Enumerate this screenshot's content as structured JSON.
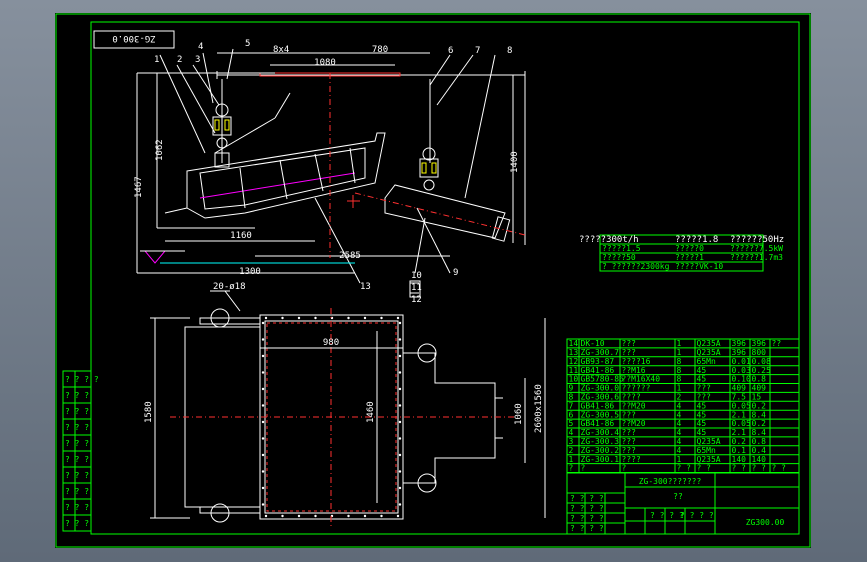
{
  "title_box": {
    "code": "ZG-300.0"
  },
  "part_numbers": [
    "1",
    "2",
    "3",
    "4",
    "5",
    "6",
    "7",
    "8",
    "9",
    "10",
    "11",
    "12",
    "13"
  ],
  "dimensions": {
    "top_8x4": "8x4",
    "top_780": "780",
    "top_1080": "1080",
    "h_1062": "1062",
    "h_1467": "1467",
    "h_1400": "1400",
    "w_1160": "1160",
    "w_1300": "1300",
    "w_2585": "2585",
    "plan_hole": "20-ø18",
    "plan_980": "980",
    "plan_1580": "1580",
    "plan_1460": "1460",
    "plan_1060": "1060",
    "plan_side": "2600x1560"
  },
  "spec_table": {
    "rows": [
      [
        "?????300t/h",
        "?????1.8",
        "??????50Hz"
      ],
      [
        "?????1.5",
        "?????0",
        "??????7.5kW"
      ],
      [
        "?????50",
        "?????1",
        "??????1.7m3"
      ],
      [
        "? ??????2300kg",
        "?????VK-10",
        ""
      ]
    ]
  },
  "parts_list": {
    "rows": [
      [
        "14",
        "DK-10",
        "???",
        "1",
        "Q235A",
        "396",
        "396",
        "??"
      ],
      [
        "13",
        "ZG-300.7",
        "???",
        "1",
        "Q235A",
        "396",
        "800",
        ""
      ],
      [
        "12",
        "GB93-87",
        "????16",
        "8",
        "65Mn",
        "0.01",
        "0.08",
        ""
      ],
      [
        "11",
        "GB41-86",
        "??M16",
        "8",
        "45",
        "0.03",
        "0.25",
        ""
      ],
      [
        "10",
        "GB5780-86",
        "??M16X40",
        "8",
        "45",
        "0.10",
        "0.8",
        ""
      ],
      [
        "9",
        "ZG-300.0",
        "??????",
        "1",
        "???",
        "409",
        "409",
        ""
      ],
      [
        "8",
        "ZG-300.6",
        "????",
        "2",
        "???",
        "7.5",
        "15",
        ""
      ],
      [
        "7",
        "GB41-86",
        "??M20",
        "4",
        "45",
        "0.05",
        "0.2",
        ""
      ],
      [
        "6",
        "ZG-300.5",
        "???",
        "4",
        "45",
        "2.1",
        "8.4",
        ""
      ],
      [
        "5",
        "GB41-86",
        "??M20",
        "4",
        "45",
        "0.05",
        "0.2",
        ""
      ],
      [
        "4",
        "ZG-300.4",
        "???",
        "4",
        "45",
        "2.1",
        "8.4",
        ""
      ],
      [
        "3",
        "ZG-300.3",
        "???",
        "4",
        "Q235A",
        "0.2",
        "0.8",
        ""
      ],
      [
        "2",
        "ZG-300.2",
        "???",
        "4",
        "65Mn",
        "0.1",
        "0.4",
        ""
      ],
      [
        "1",
        "ZG-300.1",
        "????",
        "1",
        "Q235A",
        "140",
        "140",
        ""
      ],
      [
        "?",
        "?",
        "?",
        "? ?",
        "? ?",
        "? ?",
        "? ?",
        "? ?"
      ]
    ]
  },
  "title_block": {
    "drawing_title": "ZG-300???????",
    "subtitle": "??",
    "drawing_number": "ZG300.00",
    "left_cells": [
      "? ? ? ?",
      "? ? ? ?",
      "? ? ? ?",
      "? ? ? ?"
    ],
    "mid_cells": [
      "? ? ? ?",
      "? ? ? ?"
    ]
  },
  "left_margin_cells": [
    "? ? ? ?",
    "? ? ?",
    "? ? ?",
    "? ? ?",
    "? ? ?",
    "? ? ?",
    "? ? ?",
    "? ? ?",
    "? ? ?",
    "? ? ?"
  ],
  "colors": {
    "border": "#00ff00",
    "centerline": "#ff3030",
    "text": "#ffffff",
    "accent": "#ff00ff"
  }
}
